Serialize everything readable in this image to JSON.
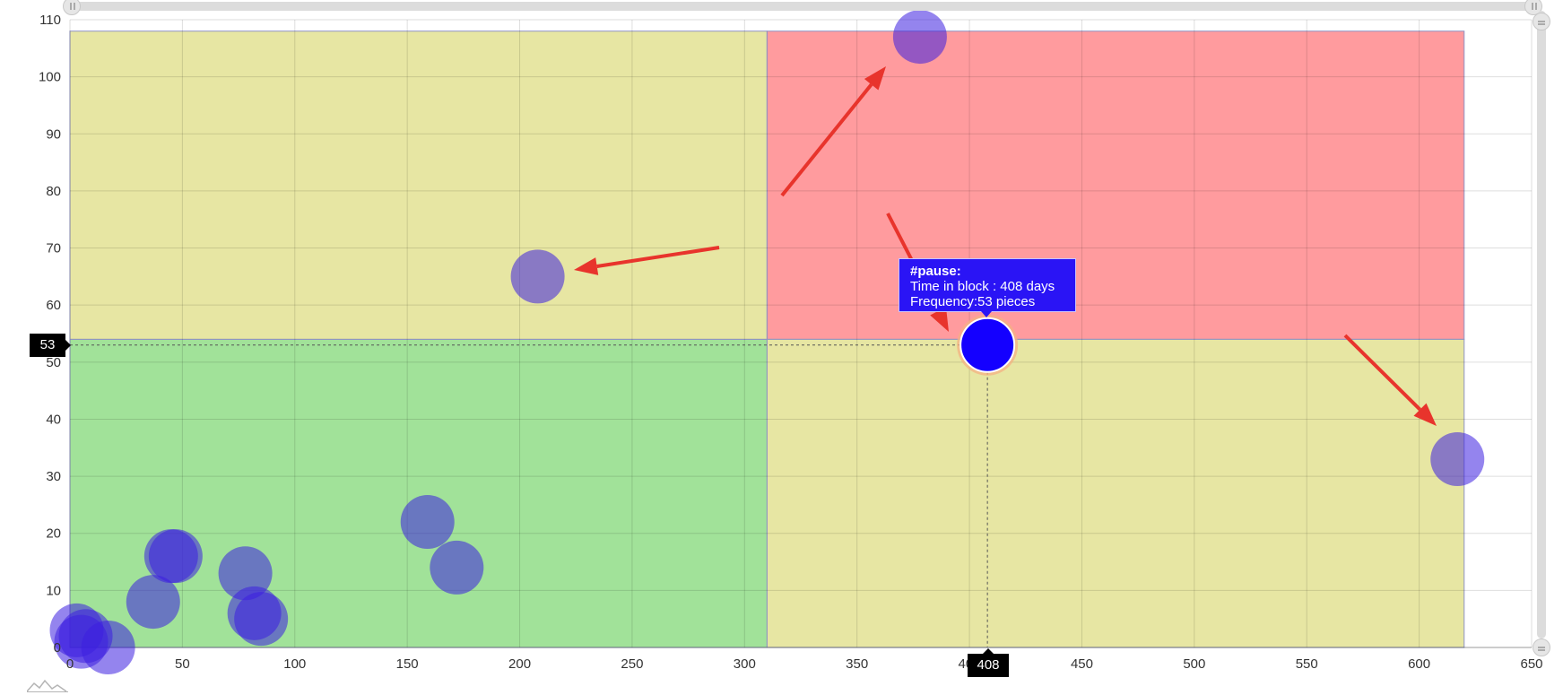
{
  "chart_data": {
    "type": "scatter",
    "xlim": [
      0,
      650
    ],
    "ylim": [
      0,
      110
    ],
    "x_ticks": [
      0,
      50,
      100,
      150,
      200,
      250,
      300,
      350,
      400,
      450,
      500,
      550,
      600,
      650
    ],
    "y_ticks": [
      0,
      10,
      20,
      30,
      40,
      50,
      60,
      70,
      80,
      90,
      100,
      110
    ],
    "grid": true,
    "regions": [
      {
        "x": [
          0,
          310
        ],
        "y": [
          0,
          54
        ],
        "color": "#67d05a"
      },
      {
        "x": [
          0,
          310
        ],
        "y": [
          54,
          108
        ],
        "color": "#d8d66a"
      },
      {
        "x": [
          310,
          620
        ],
        "y": [
          54,
          108
        ],
        "color": "#ff5d62"
      },
      {
        "x": [
          310,
          620
        ],
        "y": [
          0,
          54
        ],
        "color": "#d8d66a"
      }
    ],
    "points": [
      {
        "x": 3,
        "y": 3
      },
      {
        "x": 5,
        "y": 1
      },
      {
        "x": 7,
        "y": 2
      },
      {
        "x": 17,
        "y": 0
      },
      {
        "x": 37,
        "y": 8
      },
      {
        "x": 45,
        "y": 16
      },
      {
        "x": 47,
        "y": 16
      },
      {
        "x": 78,
        "y": 13
      },
      {
        "x": 82,
        "y": 6
      },
      {
        "x": 85,
        "y": 5
      },
      {
        "x": 159,
        "y": 22
      },
      {
        "x": 172,
        "y": 14
      },
      {
        "x": 208,
        "y": 65
      },
      {
        "x": 378,
        "y": 107
      },
      {
        "x": 408,
        "y": 53,
        "highlighted": true
      },
      {
        "x": 617,
        "y": 33
      }
    ],
    "bubble_color": "#3d1fe0",
    "highlight_color": "#1400ff",
    "crosshair": {
      "x_label": "408",
      "y_label": "53"
    }
  },
  "tooltip": {
    "title": "#pause:",
    "line1": "Time in block : 408 days",
    "line2": "Frequency:53 pieces"
  },
  "arrow_color": "#e8342c"
}
